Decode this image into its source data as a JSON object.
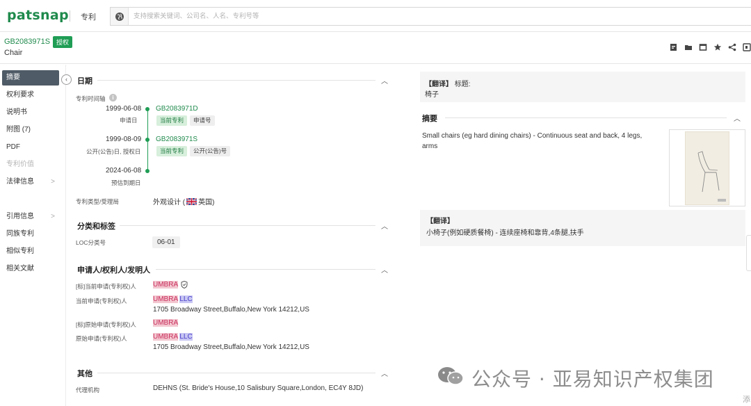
{
  "app": {
    "logo": "patsnap",
    "scope": "专利"
  },
  "search": {
    "placeholder": "支持搜索关键词、公司名、人名、专利号等"
  },
  "patent": {
    "number": "GB2083971S",
    "status_badge": "授权",
    "title": "Chair"
  },
  "toolbar": {
    "icons": [
      "pdf-download-icon",
      "folder-icon",
      "window-icon",
      "star-icon",
      "share-icon",
      "translate-icon"
    ]
  },
  "sidebar": {
    "items": [
      {
        "label": "摘要",
        "active": true
      },
      {
        "label": "权利要求"
      },
      {
        "label": "说明书"
      },
      {
        "label": "附图 (7)"
      },
      {
        "label": "PDF"
      },
      {
        "label": "专利价值",
        "disabled": true
      },
      {
        "label": "法律信息",
        "arrow": ">"
      },
      {
        "label": "引用信息",
        "arrow": ">"
      },
      {
        "label": "同族专利"
      },
      {
        "label": "相似专利"
      },
      {
        "label": "相关文献"
      }
    ]
  },
  "dates": {
    "section_title": "日期",
    "timeline_label": "专利时间轴",
    "events": [
      {
        "date": "1999-06-08",
        "label": "申请日",
        "patent": "GB2083971D",
        "tags": [
          "当前专利",
          "申请号"
        ]
      },
      {
        "date": "1999-08-09",
        "label": "公开(公告)日, 授权日",
        "patent": "GB2083971S",
        "tags": [
          "当前专利",
          "公开(公告)号"
        ]
      },
      {
        "date": "2024-06-08",
        "label": "预估到期日"
      }
    ],
    "type_label": "专利类型/受理局",
    "type_value": "外观设计 (",
    "country": "英国)"
  },
  "classification": {
    "section_title": "分类和标签",
    "loc_label": "LOC分类号",
    "loc_value": "06-01"
  },
  "parties": {
    "section_title": "申请人/权利人/发明人",
    "std_current_label": "[标]当前申请(专利权)人",
    "std_current_value": "UMBRA",
    "current_label": "当前申请(专利权)人",
    "current_value_1": "UMBRA",
    "current_value_2": "LLC",
    "current_address": "1705 Broadway Street,Buffalo,New York 14212,US",
    "std_original_label": "[标]原始申请(专利权)人",
    "std_original_value": "UMBRA",
    "original_label": "原始申请(专利权)人",
    "original_value_1": "UMBRA",
    "original_value_2": "LLC",
    "original_address": "1705 Broadway Street,Buffalo,New York 14212,US"
  },
  "other": {
    "section_title": "其他",
    "agent_label": "代理机构",
    "agent_value": "DEHNS (St. Bride's House,10 Salisbury Square,London, EC4Y 8JD)"
  },
  "right": {
    "translate_tag": "【翻译】",
    "title_label": "标题:",
    "title_translation": "椅子",
    "abstract_title": "摘要",
    "abstract_text": "Small chairs (eg hard dining chairs) - Continuous seat and back, 4 legs, arms",
    "abstract_translate_tag": "【翻译】",
    "abstract_translation": "小椅子(例如硬质餐椅) - 连续座椅和靠背,4条腿,扶手"
  },
  "watermark": {
    "text": "公众号 · 亚易知识产权集团"
  },
  "edge": {
    "text": "添"
  }
}
